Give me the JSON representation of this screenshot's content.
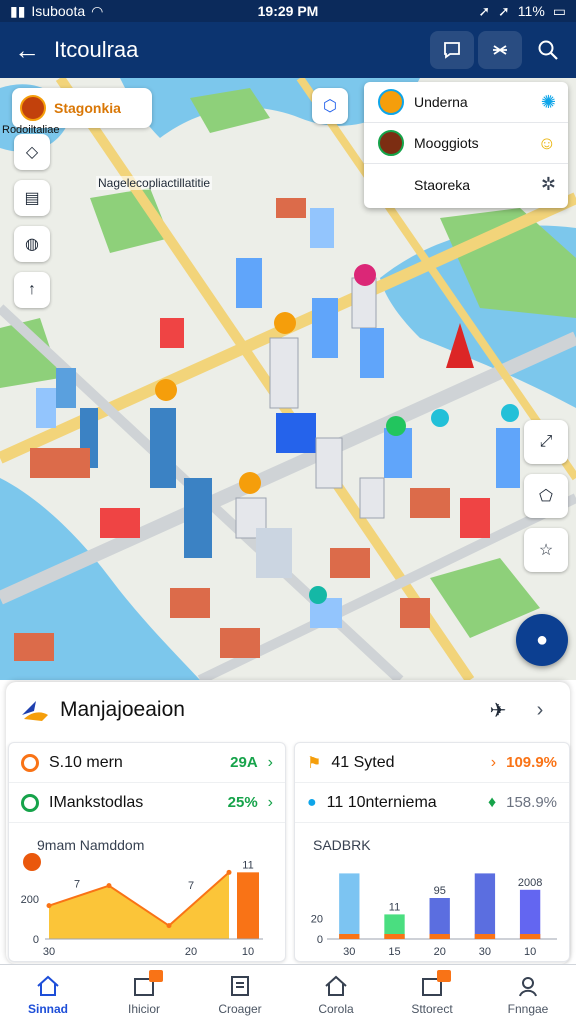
{
  "status_bar": {
    "carrier": "Isuboota",
    "time": "19:29 PM",
    "battery": "11%"
  },
  "header": {
    "title": "Itcoulraa",
    "icons": [
      "chat-square-icon",
      "tools-icon",
      "search-icon"
    ]
  },
  "map": {
    "chip": {
      "label": "Stagonkia"
    },
    "note": "Nagelecopliactillatitie",
    "small_label": "Rodoiltaliae",
    "layers": [
      {
        "name": "Underna",
        "colors": {
          "thumb": "#0ea5e9",
          "icon": "#0ea5e9"
        }
      },
      {
        "name": "Mooggiots",
        "colors": {
          "thumb": "#7c2d12",
          "icon": "#eab308"
        }
      },
      {
        "name": "Staoreka",
        "colors": {
          "thumb": "",
          "icon": "#374151"
        }
      }
    ]
  },
  "sheet": {
    "title": "Manjajoeaion",
    "left_stats": [
      {
        "label": "S.10 mern",
        "value": "29A",
        "color": "#16a34a",
        "icon_color": "#f97316"
      },
      {
        "label": "IMankstodlas",
        "value": "25%",
        "color": "#16a34a",
        "icon_color": "#16a34a"
      }
    ],
    "right_stats": [
      {
        "label": "41 Syted",
        "value": "109.9%",
        "color": "#f97316",
        "icon_color": "#f59e0b"
      },
      {
        "label": "11 10nterniema",
        "value": "158.9%",
        "color": "#6b7280",
        "icon_color": "#0ea5e9"
      }
    ],
    "left_chart_title": "9mam Namddom",
    "right_chart_title": "SADBRK"
  },
  "chart_data": [
    {
      "type": "area",
      "title": "9mam Namddom",
      "x": [
        "30",
        "",
        "20",
        "10"
      ],
      "series": [
        {
          "values": [
            5,
            8,
            2,
            10
          ]
        }
      ],
      "bar_value": 10,
      "data_labels": [
        "7",
        "7",
        "11"
      ],
      "y_ticks": [
        "200",
        "0"
      ],
      "ylim": [
        0,
        12
      ]
    },
    {
      "type": "bar",
      "title": "SADBRK",
      "categories": [
        "30",
        "15",
        "20",
        "30",
        "10"
      ],
      "values": [
        80,
        30,
        50,
        80,
        60
      ],
      "data_labels": [
        "",
        "11",
        "95",
        "",
        "2008"
      ],
      "y_ticks": [
        "20",
        "0"
      ],
      "ylim": [
        0,
        100
      ],
      "colors": [
        "#7cc4f2",
        "#4ade80",
        "#5b6ee0",
        "#5b6ee0",
        "#6366f1"
      ]
    }
  ],
  "tabs": [
    {
      "label": "Sinnad",
      "icon": "home-icon",
      "active": true
    },
    {
      "label": "Ihicior",
      "icon": "calendar-icon",
      "active": false
    },
    {
      "label": "Croager",
      "icon": "clipboard-icon",
      "active": false
    },
    {
      "label": "Corola",
      "icon": "house-icon",
      "active": false
    },
    {
      "label": "Sttorect",
      "icon": "calendar-icon",
      "active": false
    },
    {
      "label": "Fnngae",
      "icon": "profile-icon",
      "active": false
    }
  ]
}
